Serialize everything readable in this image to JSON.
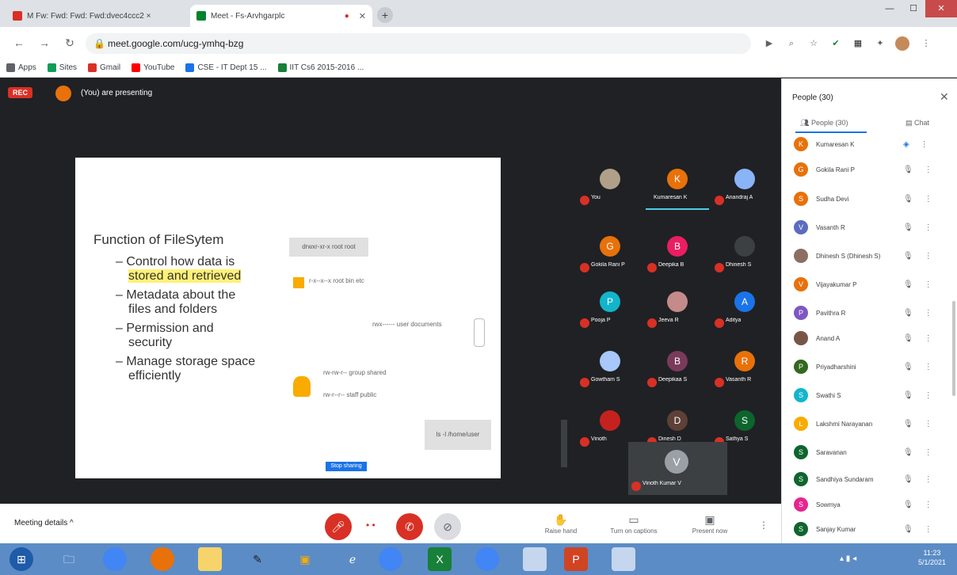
{
  "browser": {
    "tabs": [
      {
        "title": "M Fw: Fwd: Fwd: Fwd:dvec4ccc2 × ",
        "active": false
      },
      {
        "title": "Meet - Fs-Arvhgarplc",
        "active": true
      }
    ],
    "address": "meet.google.com/ucg-ymhq-bzg"
  },
  "bookmarks": [
    {
      "label": "Apps",
      "color": "#5f6368"
    },
    {
      "label": "Sites",
      "color": "#0f9d58"
    },
    {
      "label": "Gmail",
      "color": "#d93025"
    },
    {
      "label": "YouTube",
      "color": "#ff0000"
    },
    {
      "label": "CSE - IT Dept 15 ...",
      "color": "#1a73e8"
    },
    {
      "label": "IIT Cs6 2015-2016 ...",
      "color": "#188038"
    }
  ],
  "meet": {
    "rec_label": "REC",
    "presenting_label": "(You) are presenting",
    "slide": {
      "title": "Function of FileSytem",
      "bullets": [
        {
          "line1": "– Control how data is",
          "line2": "stored and retrieved",
          "highlight_line2": true
        },
        {
          "line1": "– Metadata about the",
          "line2": "files and folders",
          "highlight_line2": false
        },
        {
          "line1": "– Permission and",
          "line2": "security",
          "highlight_line2": false
        },
        {
          "line1": "– Manage storage space",
          "line2": "efficiently",
          "highlight_line2": false
        }
      ],
      "right_box": "drwxr-xr-x  root  root",
      "note1": "r-x--x--x  root  bin  etc",
      "note2": "rwx------  user  documents",
      "note3": "rw-rw-r--  group  shared",
      "note4": "rw-r--r--  staff  public",
      "bottom_button": "ls -l /home/user",
      "blue_button": "Stop sharing"
    },
    "tiles": [
      {
        "name": "You",
        "initial": "",
        "color": "#b0a08a"
      },
      {
        "name": "Kumaresan K",
        "initial": "K",
        "color": "#e8710a"
      },
      {
        "name": "Anandraj A",
        "initial": "",
        "color": "#8ab4f8"
      },
      {
        "name": "Gokila Rani P",
        "initial": "G",
        "color": "#e8710a"
      },
      {
        "name": "Deepika B",
        "initial": "B",
        "color": "#e91e63"
      },
      {
        "name": "Dhinesh S",
        "initial": "",
        "color": "#3c4043"
      },
      {
        "name": "Pooja P",
        "initial": "P",
        "color": "#12b5cb"
      },
      {
        "name": "Jeeva R",
        "initial": "",
        "color": "#c58a8a"
      },
      {
        "name": "Aditya",
        "initial": "A",
        "color": "#1a73e8"
      },
      {
        "name": "Gowtham S",
        "initial": "",
        "color": "#a8c7fa"
      },
      {
        "name": "Deepikaa S",
        "initial": "B",
        "color": "#7a3b5a"
      },
      {
        "name": "Vasanth R",
        "initial": "R",
        "color": "#e8710a"
      },
      {
        "name": "Vinoth",
        "initial": "",
        "color": "#c5221f"
      },
      {
        "name": "Dinesh D",
        "initial": "D",
        "color": "#5d4037"
      },
      {
        "name": "Sathya S",
        "initial": "S",
        "color": "#0d652d"
      }
    ],
    "bottom_tile": {
      "name": "Vinoth Kumar V",
      "initial": "V",
      "color": "#9aa0a6"
    },
    "meeting_details": "Meeting details ^",
    "actions": [
      {
        "label": "Raise hand",
        "icon": "✋"
      },
      {
        "label": "Turn on captions",
        "icon": "▭"
      },
      {
        "label": "Present now",
        "icon": "▣"
      }
    ]
  },
  "people": {
    "title": "People (30)",
    "tab_people": "People (30)",
    "tab_chat": "Chat",
    "participants": [
      {
        "name": "Kumaresan K",
        "initial": "K",
        "color": "#e8710a"
      },
      {
        "name": "Gokila Rani P",
        "initial": "G",
        "color": "#e8710a"
      },
      {
        "name": "Sudha Devi",
        "initial": "S",
        "color": "#e8710a"
      },
      {
        "name": "Vasanth R",
        "initial": "V",
        "color": "#5c6bc0"
      },
      {
        "name": "Dhinesh S (Dhinesh S)",
        "initial": "",
        "color": "#8d6e63"
      },
      {
        "name": "Vijayakumar P",
        "initial": "V",
        "color": "#e8710a"
      },
      {
        "name": "Pavithra R",
        "initial": "P",
        "color": "#7e57c2"
      },
      {
        "name": "Anand A",
        "initial": "",
        "color": "#795548"
      },
      {
        "name": "Priyadharshini",
        "initial": "P",
        "color": "#33691e"
      },
      {
        "name": "Swathi S",
        "initial": "S",
        "color": "#12b5cb"
      },
      {
        "name": "Lakshmi Narayanan",
        "initial": "L",
        "color": "#f9ab00"
      },
      {
        "name": "Saravanan",
        "initial": "S",
        "color": "#0d652d"
      },
      {
        "name": "Sandhiya Sundaram",
        "initial": "S",
        "color": "#0d652d"
      },
      {
        "name": "Sowmya",
        "initial": "S",
        "color": "#e52592"
      },
      {
        "name": "Sanjay Kumar",
        "initial": "S",
        "color": "#0d652d"
      }
    ]
  },
  "taskbar": {
    "clock_time": "11:23",
    "clock_date": "5/1/2021"
  }
}
